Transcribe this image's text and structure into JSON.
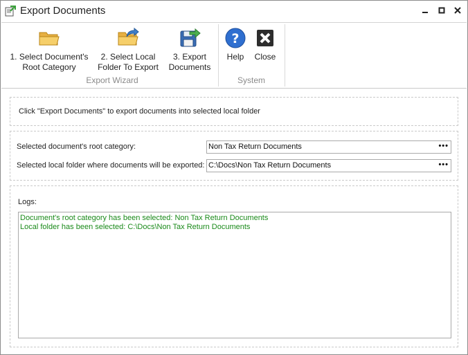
{
  "window": {
    "title": "Export Documents"
  },
  "ribbon": {
    "groups": [
      {
        "label": "Export Wizard",
        "buttons": [
          {
            "label_line1": "1. Select Document's",
            "label_line2": "Root Category",
            "icon": "folder-icon"
          },
          {
            "label_line1": "2. Select Local",
            "label_line2": "Folder To Export",
            "icon": "folder-export-icon"
          },
          {
            "label_line1": "3. Export",
            "label_line2": "Documents",
            "icon": "save-export-icon"
          }
        ]
      },
      {
        "label": "System",
        "buttons": [
          {
            "label_line1": "Help",
            "icon": "help-icon"
          },
          {
            "label_line1": "Close",
            "icon": "close-icon"
          }
        ]
      }
    ]
  },
  "info": {
    "text": "Click \"Export Documents\" to export documents into selected local folder"
  },
  "settings": {
    "root_category_label": "Selected document's root category:",
    "root_category_value": "Non Tax Return Documents",
    "local_folder_label": "Selected local folder where documents will be exported:",
    "local_folder_value": "C:\\Docs\\Non Tax Return Documents",
    "browse_label": "•••"
  },
  "logs": {
    "label": "Logs:",
    "lines": [
      "Document's root category has been selected: Non Tax Return Documents",
      "Local folder has been selected: C:\\Docs\\Non Tax Return Documents"
    ]
  },
  "colors": {
    "log_text": "#1a8a1a",
    "help_blue": "#2f6fd0"
  }
}
